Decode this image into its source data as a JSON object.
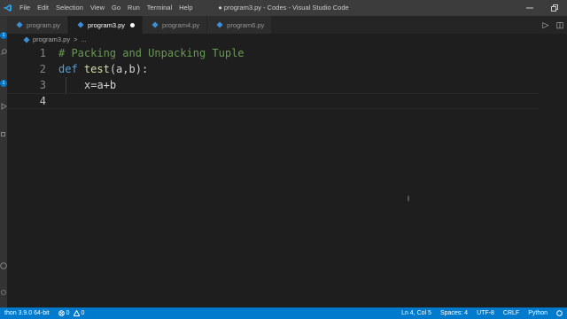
{
  "titlebar": {
    "menu": [
      "File",
      "Edit",
      "Selection",
      "View",
      "Go",
      "Run",
      "Terminal",
      "Help"
    ],
    "window_title": "● program3.py - Codes - Visual Studio Code"
  },
  "activitybar": {
    "badges": [
      "1",
      "1"
    ]
  },
  "tabs": [
    {
      "label": "program.py",
      "active": false
    },
    {
      "label": "program3.py",
      "active": true,
      "dirty": true
    },
    {
      "label": "program4.py",
      "active": false
    },
    {
      "label": "program6.py",
      "active": false
    }
  ],
  "tab_actions": {
    "run": "▷",
    "split": "◫",
    "more": "···"
  },
  "breadcrumb": {
    "file": "program3.py",
    "sep": ">",
    "symbol": "..."
  },
  "editor": {
    "lines": [
      {
        "number": "1",
        "comment": "# Packing and Unpacking Tuple"
      },
      {
        "number": "2",
        "keyword": "def",
        "fn": "test",
        "rest": "(a,b):"
      },
      {
        "number": "3",
        "code": "x=a+b"
      },
      {
        "number": "4",
        "code": ""
      }
    ]
  },
  "statusbar": {
    "python": "thon 3.9.0 64-bit",
    "errors": "0",
    "warnings": "0",
    "position": "Ln 4, Col 5",
    "spaces": "Spaces: 4",
    "encoding": "UTF-8",
    "eol": "CRLF",
    "language": "Python"
  },
  "colors": {
    "accent": "#007acc",
    "comment": "#6a9955",
    "keyword": "#569cd6",
    "function": "#dcdcaa"
  }
}
